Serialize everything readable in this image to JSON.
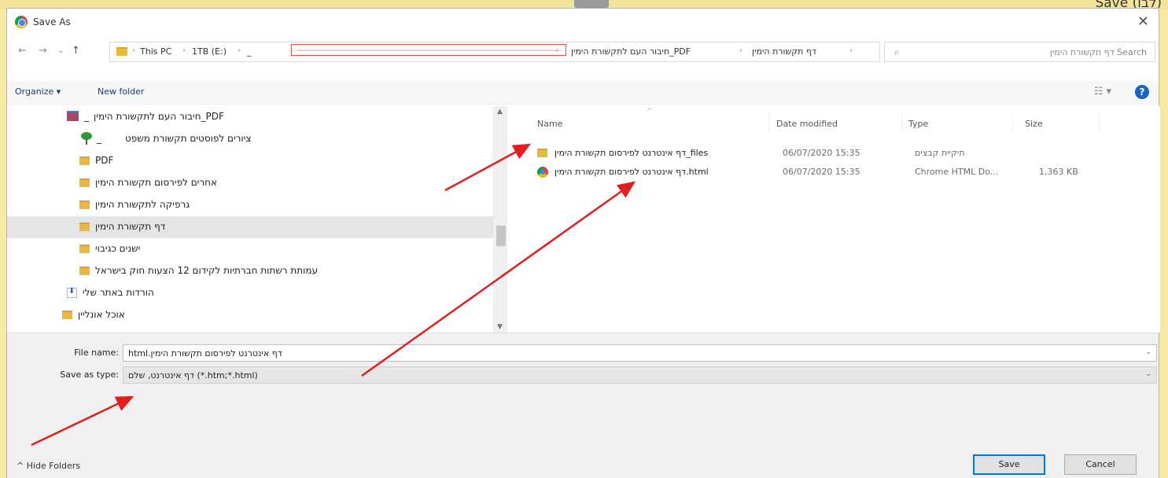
{
  "background": {
    "top_text": "Save (לבו)"
  },
  "dialog": {
    "title": "Save As",
    "close_glyph": "✕"
  },
  "nav": {
    "back": "←",
    "forward": "→",
    "recent": "⌄",
    "up": "↑",
    "breadcrumbs_left": [
      "This PC",
      "1TB (E:)",
      "_"
    ],
    "breadcrumbs_right": [
      "PDF_חיבור העם לתקשורת הימין",
      "דף תקשורת הימין"
    ],
    "refresh": "↻",
    "search_placeholder": "Search דף תקשורת הימין"
  },
  "toolbar": {
    "organize": "Organize ▾",
    "new_folder": "New folder",
    "view": "☷ ▾",
    "help": "?"
  },
  "tree": {
    "items": [
      {
        "label": "PDF_חיבור העם לתקשורת הימין",
        "prefix": "_",
        "icon": "rar-archive-icon"
      },
      {
        "label": "ציורים לפוסטים תקשורת משפט",
        "prefix": "_",
        "icon": "green-tree-icon"
      },
      {
        "label": "PDF",
        "icon": "folder-icon"
      },
      {
        "label": "אחרים לפירסום תקשורת הימין",
        "icon": "folder-icon"
      },
      {
        "label": "גרפיקה לתקשורת הימין",
        "icon": "folder-icon"
      },
      {
        "label": "דף תקשורת הימין",
        "icon": "folder-icon",
        "selected": true
      },
      {
        "label": "ישנים כגיבוי",
        "icon": "folder-icon"
      },
      {
        "label": "עמותת רשתות חברתיות לקידום 12 הצעות חוק בישראל",
        "icon": "folder-icon"
      },
      {
        "label": "הורדות באתר שלי",
        "icon": "download-icon"
      },
      {
        "label": "אוכל אונליין",
        "icon": "folder-icon"
      }
    ]
  },
  "list": {
    "columns": [
      "Name",
      "Date modified",
      "Type",
      "Size"
    ],
    "rows": [
      {
        "name": "דף אינטרנט לפירסום תקשורת הימין_files",
        "date": "06/07/2020 15:35",
        "type": "תיקיית קבצים",
        "size": "",
        "icon": "folder-icon"
      },
      {
        "name": "דף אינטרנט לפירסום תקשורת הימין.html",
        "date": "06/07/2020 15:35",
        "type": "Chrome HTML Do...",
        "size": "1,363 KB",
        "icon": "chrome-icon"
      }
    ]
  },
  "form": {
    "file_name_label": "File name:",
    "file_name_value": "דף אינטרנט לפירסום תקשורת הימין.html",
    "save_type_label": "Save as type:",
    "save_type_value": "דף אינטרנט, שלם (*.htm;*.html)"
  },
  "footer": {
    "hide_folders": "^ Hide Folders",
    "save": "Save",
    "cancel": "Cancel"
  },
  "colors": {
    "annotation_arrow": "#e02020",
    "accent": "#0078d7"
  }
}
